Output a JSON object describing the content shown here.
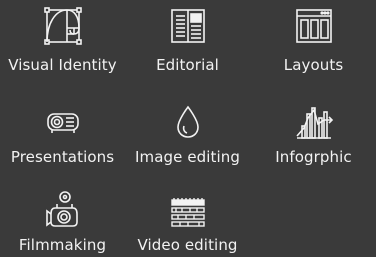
{
  "items": [
    {
      "label": "Visual Identity",
      "icon": "golden-ratio-icon"
    },
    {
      "label": "Editorial",
      "icon": "newspaper-icon"
    },
    {
      "label": "Layouts",
      "icon": "layout-columns-icon"
    },
    {
      "label": "Presentations",
      "icon": "projector-icon"
    },
    {
      "label": "Image editing",
      "icon": "ink-drop-icon"
    },
    {
      "label": "Infogrphic",
      "icon": "chart-icon"
    },
    {
      "label": "Filmmaking",
      "icon": "camera-icon"
    },
    {
      "label": "Video editing",
      "icon": "timeline-icon"
    }
  ],
  "colors": {
    "background": "#3a3a3a",
    "foreground": "#f2f2f2"
  }
}
